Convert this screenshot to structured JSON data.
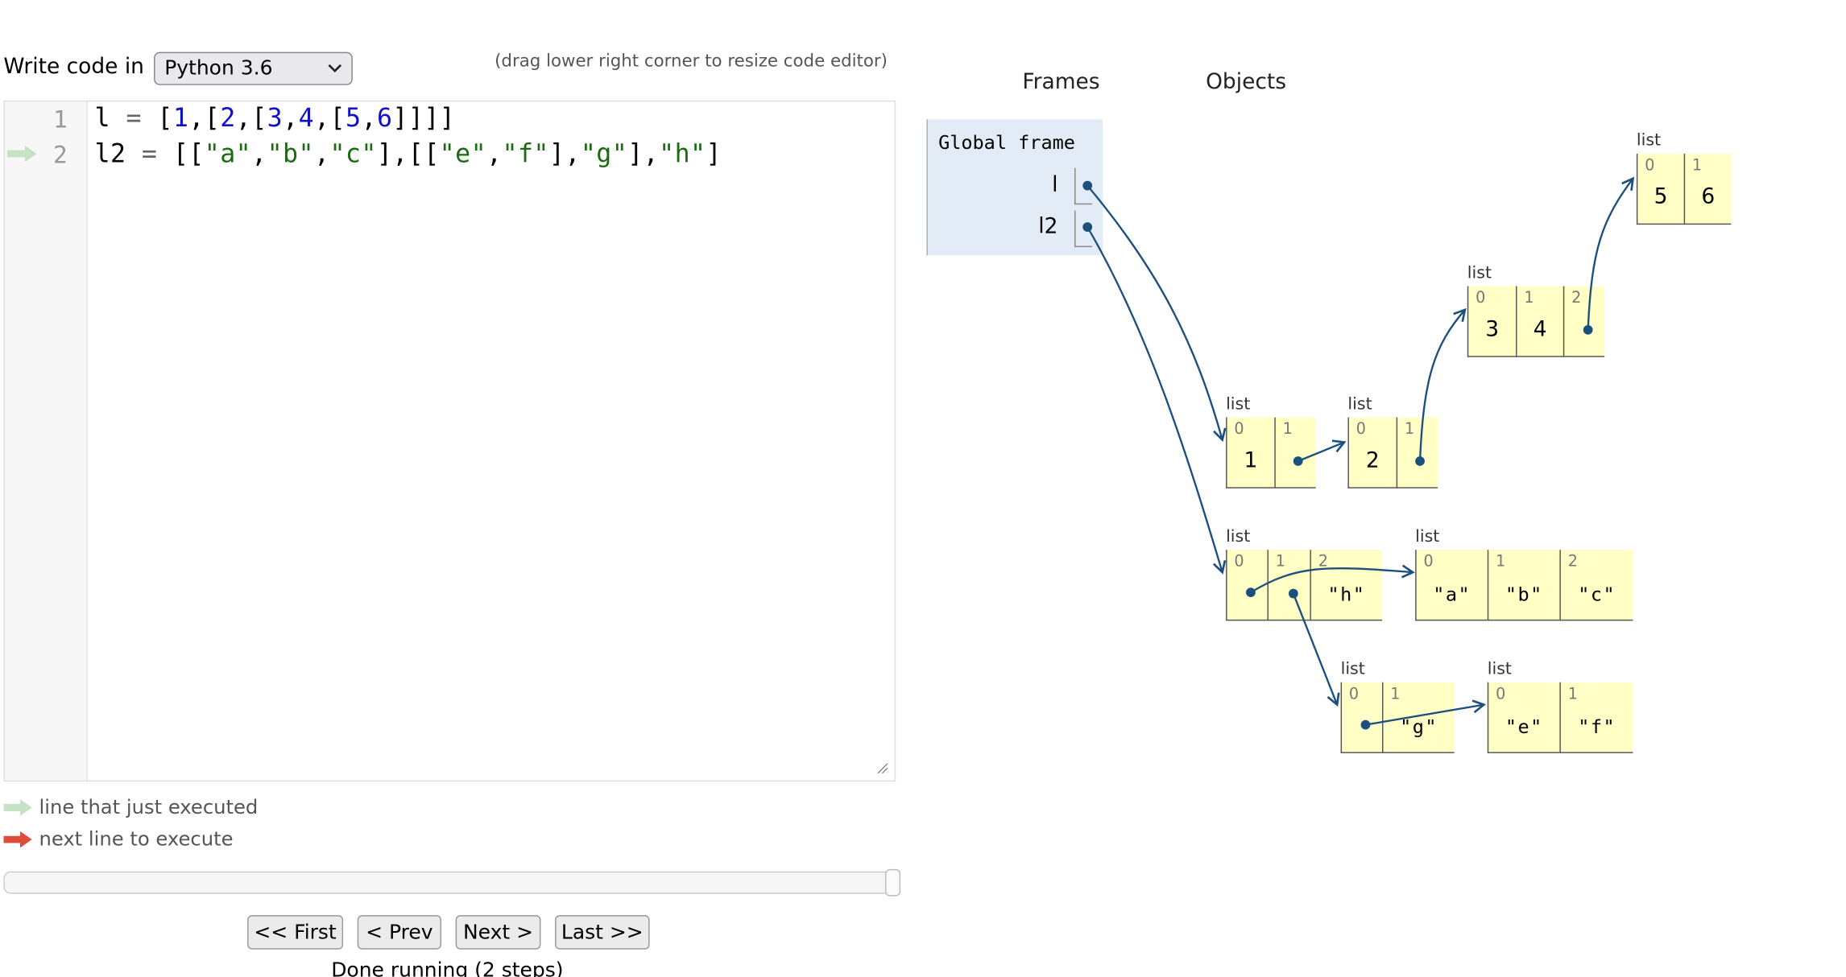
{
  "editor": {
    "write_label": "Write code in",
    "language": "Python 3.6",
    "drag_hint": "(drag lower right corner to resize code editor)",
    "lines": [
      {
        "number": "1",
        "tokens": [
          [
            "l ",
            ""
          ],
          [
            "=",
            "op"
          ],
          [
            " [",
            ""
          ],
          [
            "1",
            "num"
          ],
          [
            ",[",
            ""
          ],
          [
            "2",
            "num"
          ],
          [
            ",[",
            ""
          ],
          [
            "3",
            "num"
          ],
          [
            ",",
            ""
          ],
          [
            "4",
            "num"
          ],
          [
            ",[",
            ""
          ],
          [
            "5",
            "num"
          ],
          [
            ",",
            ""
          ],
          [
            "6",
            "num"
          ],
          [
            "]]]]",
            ""
          ]
        ]
      },
      {
        "number": "2",
        "tokens": [
          [
            "l2 ",
            ""
          ],
          [
            "=",
            "op"
          ],
          [
            " [[",
            ""
          ],
          [
            "\"a\"",
            "str"
          ],
          [
            ",",
            ""
          ],
          [
            "\"b\"",
            "str"
          ],
          [
            ",",
            ""
          ],
          [
            "\"c\"",
            "str"
          ],
          [
            "],[[",
            ""
          ],
          [
            "\"e\"",
            "str"
          ],
          [
            ",",
            ""
          ],
          [
            "\"f\"",
            "str"
          ],
          [
            "],",
            ""
          ],
          [
            "\"g\"",
            "str"
          ],
          [
            "],",
            ""
          ],
          [
            "\"h\"",
            "str"
          ],
          [
            "]",
            ""
          ]
        ]
      }
    ],
    "current_line_marker": "line 2"
  },
  "legend": {
    "just_executed": "line that just executed",
    "next_line": "next line to execute",
    "just_executed_color": "#c5e2c3",
    "next_line_color": "#e04b3a"
  },
  "slider": {
    "value": 2,
    "max": 2
  },
  "nav": {
    "first": "<< First",
    "prev": "< Prev",
    "next": "Next >",
    "last": "Last >>"
  },
  "status": "Done running (2 steps)",
  "viz": {
    "frames_header": "Frames",
    "objects_header": "Objects",
    "global_frame": {
      "title": "Global frame",
      "vars": [
        "l",
        "l2"
      ]
    },
    "arrow_color": "#1d4f7c",
    "objects": [
      {
        "id": "L1",
        "type": "list",
        "cells": [
          [
            "0",
            "1"
          ],
          [
            "1",
            "*"
          ]
        ]
      },
      {
        "id": "L2",
        "type": "list",
        "cells": [
          [
            "0",
            "2"
          ],
          [
            "1",
            "*"
          ]
        ]
      },
      {
        "id": "L3",
        "type": "list",
        "cells": [
          [
            "0",
            "3"
          ],
          [
            "1",
            "4"
          ],
          [
            "2",
            "*"
          ]
        ]
      },
      {
        "id": "L4",
        "type": "list",
        "cells": [
          [
            "0",
            "5"
          ],
          [
            "1",
            "6"
          ]
        ]
      },
      {
        "id": "M1",
        "type": "list",
        "cells": [
          [
            "0",
            "*"
          ],
          [
            "1",
            "*"
          ],
          [
            "2",
            "\"h\""
          ]
        ]
      },
      {
        "id": "M2",
        "type": "list",
        "cells": [
          [
            "0",
            "\"a\""
          ],
          [
            "1",
            "\"b\""
          ],
          [
            "2",
            "\"c\""
          ]
        ]
      },
      {
        "id": "M3",
        "type": "list",
        "cells": [
          [
            "0",
            "*"
          ],
          [
            "1",
            "\"g\""
          ]
        ]
      },
      {
        "id": "M4",
        "type": "list",
        "cells": [
          [
            "0",
            "\"e\""
          ],
          [
            "1",
            "\"f\""
          ]
        ]
      }
    ]
  }
}
